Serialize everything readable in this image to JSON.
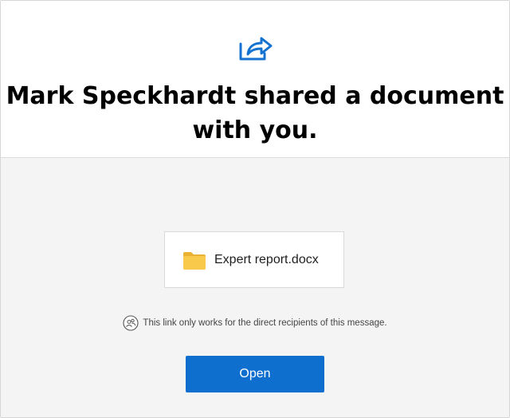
{
  "header": {
    "share_icon": "share-icon",
    "title": "Mark Speckhardt shared a document with you."
  },
  "file": {
    "icon": "folder-icon",
    "name": "Expert report.docx"
  },
  "notice": {
    "icon": "people-icon",
    "text": "This link only works for the direct recipients of this message."
  },
  "actions": {
    "open_label": "Open"
  },
  "colors": {
    "accent": "#0f6fcf",
    "folder": "#f8c94a",
    "body_background": "#f4f4f4"
  }
}
